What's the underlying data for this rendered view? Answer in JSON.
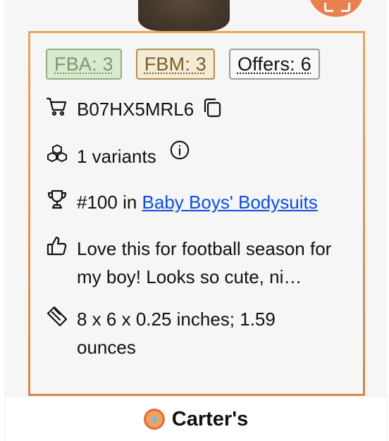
{
  "badges": {
    "fba": "FBA: 3",
    "fbm": "FBM: 3",
    "offers": "Offers: 6"
  },
  "asin": "B07HX5MRL6",
  "variants": "1 variants",
  "rank": {
    "prefix": "#100 in ",
    "category": "Baby Boys' Bodysuits"
  },
  "review": "Love this for football season for my boy! Looks so cute, ni…",
  "dimensions": "8 x 6 x 0.25 inches; 1.59 ounces",
  "brand": "Carter's",
  "icons": {
    "cart": "cart-icon",
    "copy": "copy-icon",
    "variants": "cubes-icon",
    "info": "info-icon",
    "rank": "trophy-icon",
    "review": "thumbs-up-icon",
    "dimensions": "ruler-icon"
  },
  "colors": {
    "card_border_top": "#e8a65a",
    "card_border_bottom": "#d8834e",
    "link": "#0b4de0",
    "fba_bg": "#d9ead0",
    "fbm_bg": "#f2ebd6",
    "fab": "#e8804f"
  }
}
